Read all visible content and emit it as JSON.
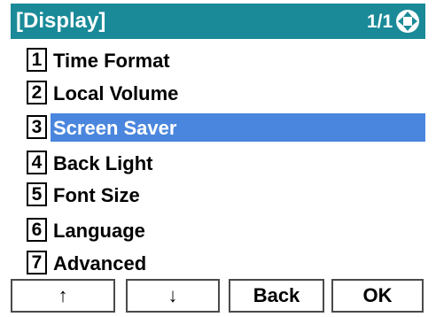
{
  "header": {
    "title": "[Display]",
    "page_indicator": "1/1",
    "nav_icon": "four-way-navigation-icon",
    "background_color": "#1a8a98"
  },
  "menu": {
    "selected_index": 3,
    "highlight_color": "#4a86de",
    "items": [
      {
        "number": "1",
        "label": "Time Format"
      },
      {
        "number": "2",
        "label": "Local Volume"
      },
      {
        "number": "3",
        "label": "Screen Saver"
      },
      {
        "number": "4",
        "label": "Back Light"
      },
      {
        "number": "5",
        "label": "Font Size"
      },
      {
        "number": "6",
        "label": "Language"
      },
      {
        "number": "7",
        "label": "Advanced"
      }
    ]
  },
  "softkeys": {
    "up": "↑",
    "down": "↓",
    "back": "Back",
    "ok": "OK"
  }
}
